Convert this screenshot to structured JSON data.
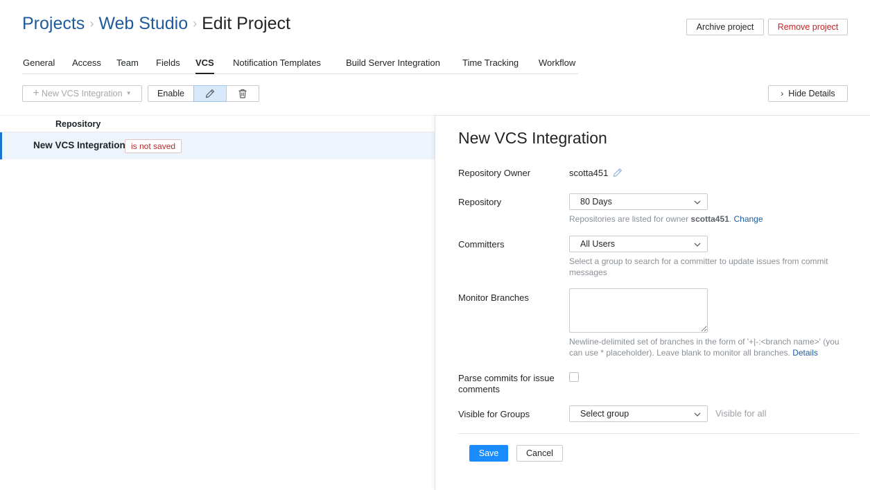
{
  "breadcrumb": {
    "projects": "Projects",
    "project": "Web Studio",
    "current": "Edit Project",
    "separator": "›"
  },
  "header_actions": {
    "archive": "Archive project",
    "remove": "Remove project"
  },
  "tabs": [
    {
      "label": "General"
    },
    {
      "label": "Access"
    },
    {
      "label": "Team"
    },
    {
      "label": "Fields"
    },
    {
      "label": "VCS",
      "active": true
    },
    {
      "label": "Notification Templates"
    },
    {
      "label": "Build Server Integration"
    },
    {
      "label": "Time Tracking"
    },
    {
      "label": "Workflow"
    }
  ],
  "toolbar": {
    "new_integration": "New VCS Integration",
    "enable": "Enable",
    "edit_icon": "pencil-icon",
    "delete_icon": "trash-icon",
    "hide_details": "Hide Details"
  },
  "list": {
    "column_header": "Repository",
    "rows": [
      {
        "title": "New VCS Integration",
        "badge": "is not saved"
      }
    ]
  },
  "panel": {
    "title": "New VCS Integration",
    "owner": {
      "label": "Repository Owner",
      "value": "scotta451"
    },
    "repository": {
      "label": "Repository",
      "value": "80 Days",
      "hint_prefix": "Repositories are listed for owner ",
      "hint_owner": "scotta451",
      "hint_suffix": ".",
      "hint_link": "Change"
    },
    "committers": {
      "label": "Committers",
      "value": "All Users",
      "hint": "Select a group to search for a committer to update issues from commit messages"
    },
    "branches": {
      "label": "Monitor Branches",
      "hint": "Newline-delimited set of branches in the form of '+|-:<branch name>' (you can use * placeholder). Leave blank to monitor all branches.",
      "hint_link": "Details"
    },
    "parse_commits": {
      "label": "Parse commits for issue comments",
      "checked": false
    },
    "visible_groups": {
      "label": "Visible for Groups",
      "value": "Select group",
      "note": "Visible for all"
    },
    "save": "Save",
    "cancel": "Cancel"
  },
  "colors": {
    "accent": "#1a8cff",
    "link": "#1e5b9c",
    "danger": "#c22323",
    "selected_row": "#edf4fb"
  }
}
